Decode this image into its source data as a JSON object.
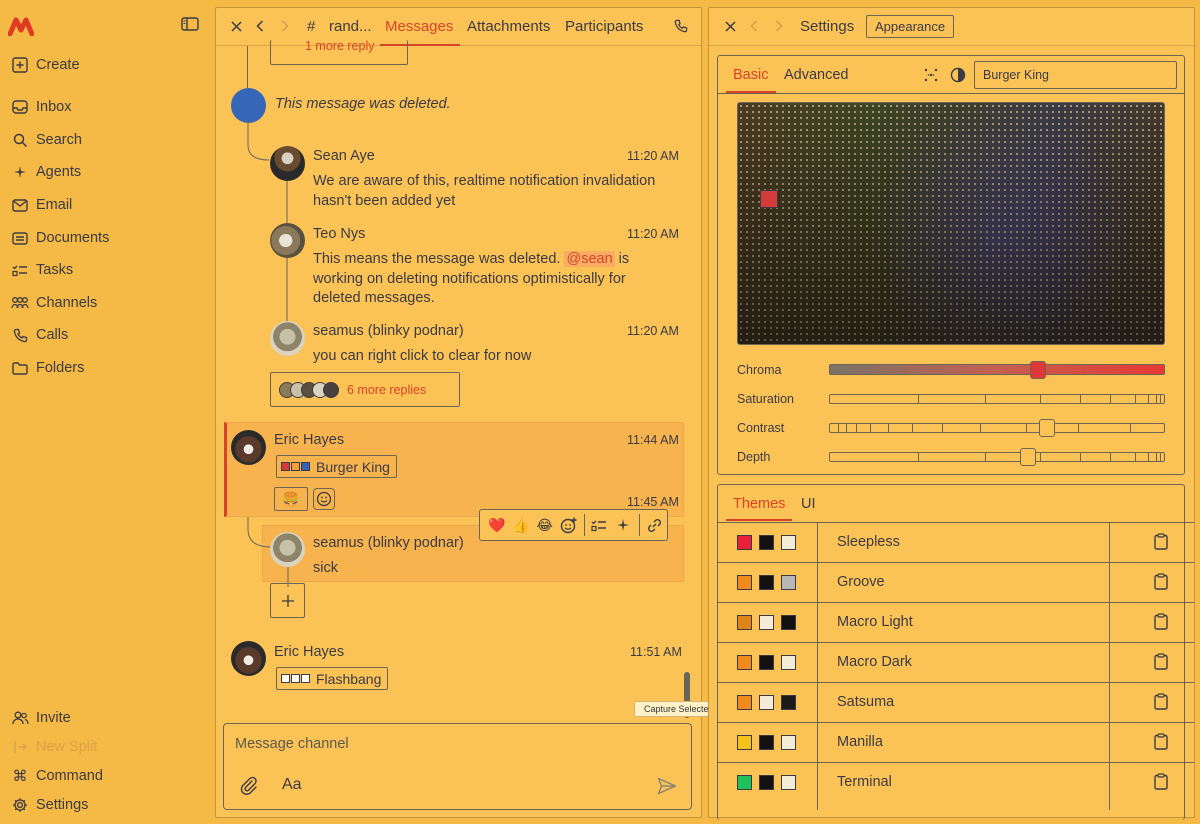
{
  "sidebar": {
    "items": [
      {
        "label": "Create",
        "icon": "plus-square-icon"
      },
      {
        "label": "Inbox",
        "icon": "inbox-icon"
      },
      {
        "label": "Search",
        "icon": "search-icon"
      },
      {
        "label": "Agents",
        "icon": "sparkle-icon"
      },
      {
        "label": "Email",
        "icon": "mail-icon"
      },
      {
        "label": "Documents",
        "icon": "document-icon"
      },
      {
        "label": "Tasks",
        "icon": "tasks-icon"
      },
      {
        "label": "Channels",
        "icon": "channels-icon"
      },
      {
        "label": "Calls",
        "icon": "phone-icon"
      },
      {
        "label": "Folders",
        "icon": "folder-icon"
      }
    ],
    "bottom": [
      {
        "label": "Invite",
        "icon": "users-icon"
      },
      {
        "label": "New Split",
        "icon": "split-icon"
      },
      {
        "label": "Command",
        "icon": "command-icon"
      },
      {
        "label": "Settings",
        "icon": "gear-icon"
      }
    ]
  },
  "channel": {
    "name": "rand...",
    "tabs": [
      "Messages",
      "Attachments",
      "Participants"
    ],
    "active_tab": "Messages"
  },
  "messages": {
    "top_reply": "1 more reply",
    "deleted": "This message was deleted.",
    "thread": [
      {
        "name": "Sean Aye",
        "time": "11:20 AM",
        "text": "We are aware of this, realtime notification invalidation hasn't been added yet"
      },
      {
        "name": "Teo Nys",
        "time": "11:20 AM",
        "text_before": "This means the message was deleted.",
        "mention": "@sean",
        "text_after": "is working on deleting notifications optimistically for deleted messages."
      },
      {
        "name": "seamus (blinky podnar)",
        "time": "11:20 AM",
        "text": "you can right click to clear for now"
      }
    ],
    "more_replies": "6 more replies",
    "eric1": {
      "name": "Eric Hayes",
      "time": "11:44 AM",
      "chip": "Burger King",
      "chip_colors": [
        "#d63b3b",
        "#f3a03a",
        "#3b5fb5"
      ],
      "reaction": "🍔",
      "time2": "11:45 AM"
    },
    "seamus2": {
      "name": "seamus (blinky podnar)",
      "text": "sick"
    },
    "eric2": {
      "name": "Eric Hayes",
      "time": "11:51 AM",
      "chip": "Flashbang",
      "chip_colors": [
        "#ffffff",
        "#ffffff",
        "#ffffff"
      ]
    },
    "reactions": [
      "❤️",
      "👍",
      "😂"
    ],
    "composer_placeholder": "Message channel",
    "tooltip": "Capture Selected Window"
  },
  "settings": {
    "title": "Settings",
    "badge": "Appearance",
    "tabs": [
      "Basic",
      "Advanced"
    ],
    "search_value": "Burger King",
    "sliders": [
      {
        "label": "Chroma",
        "value": 0.62
      },
      {
        "label": "Saturation",
        "value": null
      },
      {
        "label": "Contrast",
        "value": 0.65
      },
      {
        "label": "Depth",
        "value": 0.59
      }
    ],
    "theme_tabs": [
      "Themes",
      "UI"
    ],
    "themes": [
      {
        "name": "Sleepless",
        "colors": [
          "#e8203a",
          "#111111",
          "#f5ecd8"
        ]
      },
      {
        "name": "Groove",
        "colors": [
          "#f08a1c",
          "#111111",
          "#b9b7b3"
        ]
      },
      {
        "name": "Macro Light",
        "colors": [
          "#e0841a",
          "#f5ecd8",
          "#111111"
        ]
      },
      {
        "name": "Macro Dark",
        "colors": [
          "#f08a1c",
          "#111111",
          "#f5ecd8"
        ]
      },
      {
        "name": "Satsuma",
        "colors": [
          "#f08a1c",
          "#f5ecd8",
          "#1a1a1a"
        ]
      },
      {
        "name": "Manilla",
        "colors": [
          "#f5c21c",
          "#111111",
          "#f5ecd8"
        ]
      },
      {
        "name": "Terminal",
        "colors": [
          "#1fc25a",
          "#111111",
          "#f5ecd8"
        ]
      }
    ]
  },
  "colors": {
    "accent": "#d94328",
    "background": "#f5b945",
    "ink": "#3b3a44"
  }
}
